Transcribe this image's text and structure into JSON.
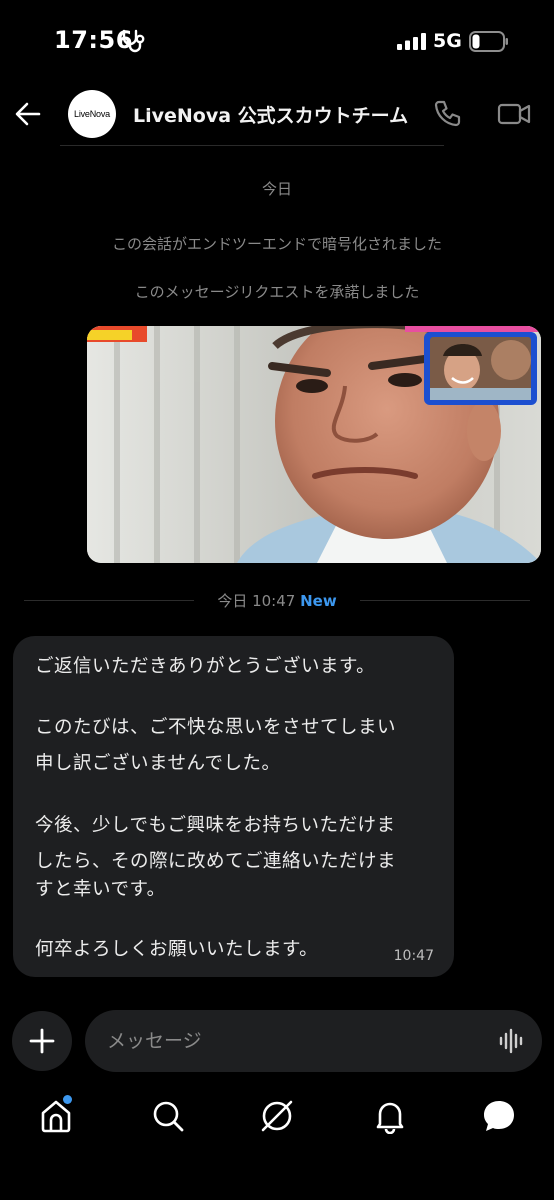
{
  "status_bar": {
    "time": "17:56",
    "network": "5G"
  },
  "header": {
    "avatar_text": "LiveNova",
    "title": "LiveNova 公式スカウトチーム"
  },
  "system_messages": {
    "today": "今日",
    "e2e": "この会話がエンドツーエンドで暗号化されました",
    "accepted": "このメッセージリクエストを承諾しました"
  },
  "divider": {
    "label": "今日 10:47",
    "badge": "New"
  },
  "message": {
    "lines": [
      "ご返信いただきありがとうございます。",
      "",
      "このたびは、ご不快な思いをさせてしまい",
      "申し訳ございませんでした。",
      "",
      "今後、少しでもご興味をお持ちいただけま",
      "したら、その際に改めてご連絡いただけま",
      "すと幸いです。",
      "",
      "何卒よろしくお願いいたします。"
    ],
    "time": "10:47"
  },
  "composer": {
    "placeholder": "メッセージ"
  },
  "colors": {
    "accent": "#3d98ef",
    "bubble": "#1e1f21",
    "background": "#000000"
  },
  "nav": [
    "home-icon",
    "search-icon",
    "explore-icon",
    "bell-icon",
    "chat-icon"
  ]
}
